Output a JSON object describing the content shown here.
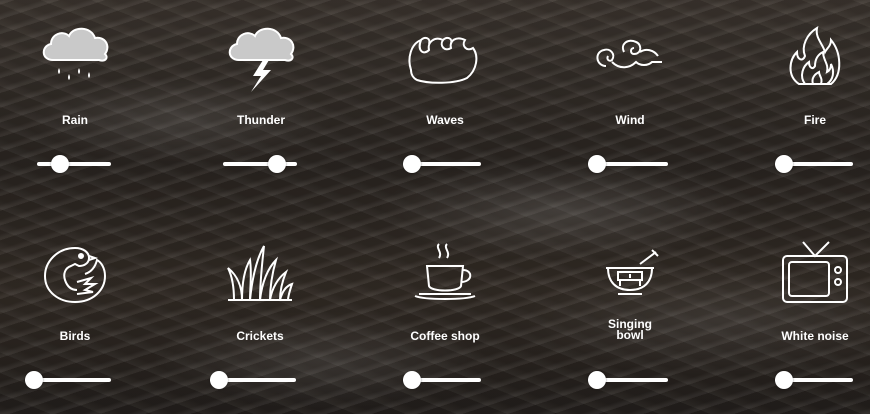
{
  "sounds": [
    {
      "label": "Rain",
      "icon": "rain-cloud-icon",
      "volume": 0.25
    },
    {
      "label": "Thunder",
      "icon": "thunder-cloud-icon",
      "volume": 0.8
    },
    {
      "label": "Waves",
      "icon": "waves-icon",
      "volume": 0
    },
    {
      "label": "Wind",
      "icon": "wind-icon",
      "volume": 0
    },
    {
      "label": "Fire",
      "icon": "fire-icon",
      "volume": 0
    },
    {
      "label": "Birds",
      "icon": "bird-icon",
      "volume": 0
    },
    {
      "label": "Crickets",
      "icon": "grass-icon",
      "volume": 0
    },
    {
      "label": "Coffee shop",
      "icon": "coffee-cup-icon",
      "volume": 0
    },
    {
      "label": "Singing\nbowl",
      "icon": "singing-bowl-icon",
      "volume": 0
    },
    {
      "label": "White noise",
      "icon": "tv-icon",
      "volume": 0
    }
  ]
}
